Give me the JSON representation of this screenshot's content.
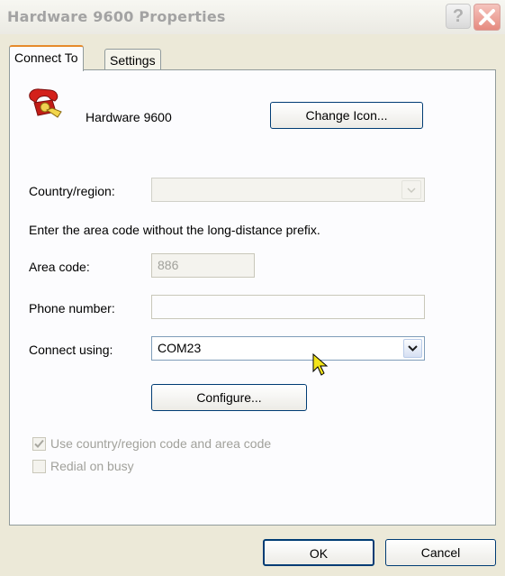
{
  "window": {
    "title": "Hardware 9600 Properties",
    "help_label": "?"
  },
  "tabs": [
    {
      "label": "Connect To",
      "active": true
    },
    {
      "label": "Settings",
      "active": false
    }
  ],
  "connection": {
    "name": "Hardware 9600",
    "change_icon_label": "Change Icon..."
  },
  "country": {
    "label": "Country/region:",
    "value": ""
  },
  "instructions": "Enter the area code without the long-distance prefix.",
  "area_code": {
    "label": "Area code:",
    "value": "886"
  },
  "phone": {
    "label": "Phone number:",
    "value": ""
  },
  "connect_using": {
    "label": "Connect using:",
    "value": "COM23"
  },
  "configure_label": "Configure...",
  "options": {
    "use_country_code": {
      "label": "Use country/region code and area code",
      "checked": true
    },
    "redial_on_busy": {
      "label": "Redial on busy",
      "checked": false
    }
  },
  "footer": {
    "ok_label": "OK",
    "cancel_label": "Cancel"
  },
  "colors": {
    "accent_tab": "#e68b2c",
    "button_border": "#003c74",
    "close_button": "#e68a7f"
  }
}
